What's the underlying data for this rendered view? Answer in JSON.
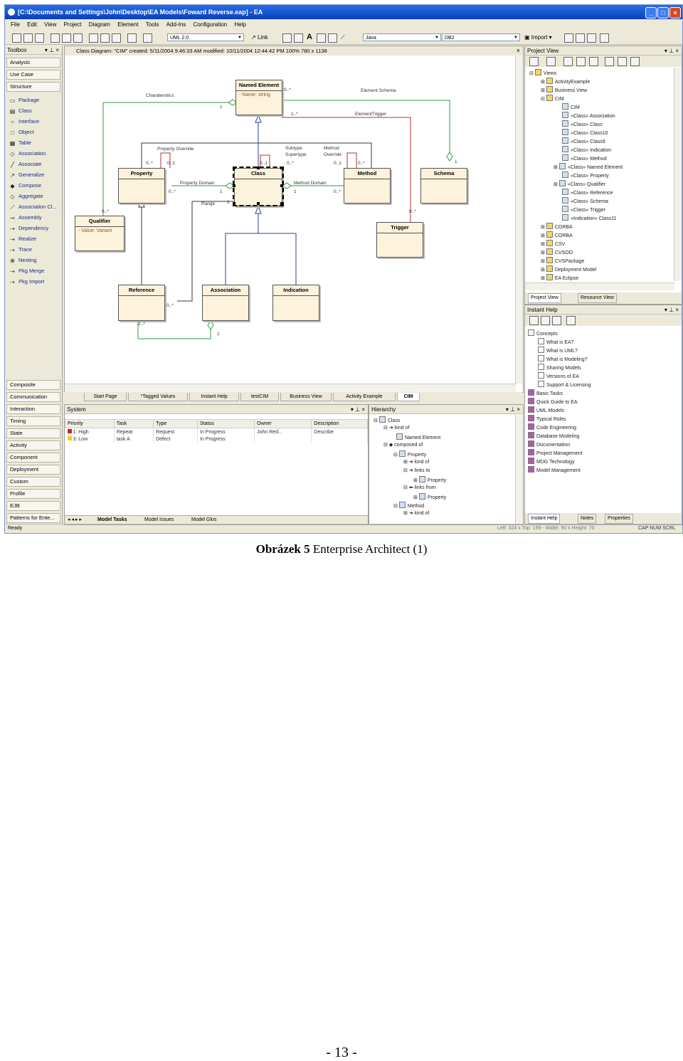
{
  "window": {
    "title": "[C:\\Documents and Settings\\John\\Desktop\\EA Models\\Foward Reverse.eap] - EA"
  },
  "menu": [
    "File",
    "Edit",
    "View",
    "Project",
    "Diagram",
    "Element",
    "Tools",
    "Add-Ins",
    "Configuration",
    "Help"
  ],
  "toolbar": {
    "uml_combo": "UML 2.0",
    "link_label": "Link",
    "lang_combo": "Java",
    "db_combo": "DB2",
    "import_label": "Import"
  },
  "toolbox": {
    "title": "Toolbox",
    "top_categories": [
      "Analysis",
      "Use Case",
      "Structure"
    ],
    "items": [
      "Package",
      "Class",
      "Interface",
      "Object",
      "Table",
      "Association",
      "Associate",
      "Generalize",
      "Compose",
      "Aggregate",
      "Association Cl...",
      "Assembly",
      "Dependency",
      "Realize",
      "Trace",
      "Nesting",
      "Pkg Merge",
      "Pkg Import"
    ],
    "bottom_categories": [
      "Composite",
      "Communication",
      "Interaction",
      "Timing",
      "State",
      "Activity",
      "Component",
      "Deployment",
      "Custom",
      "Profile",
      "EJB",
      "Patterns for Ente..."
    ]
  },
  "diagram": {
    "header": "Class Diagram: \"CIM\"   created: 5/11/2004 9:46:33 AM  modified: 10/11/2004 12:44:42 PM   100%   780 x 1138",
    "classes": {
      "named_element": {
        "name": "Named Element",
        "attr": "-  Name:  string"
      },
      "property": {
        "name": "Property"
      },
      "class": {
        "name": "Class"
      },
      "method": {
        "name": "Method"
      },
      "schema": {
        "name": "Schema"
      },
      "qualifier": {
        "name": "Qualifier",
        "attr": "-  Value:  Variant"
      },
      "trigger": {
        "name": "Trigger"
      },
      "reference": {
        "name": "Reference"
      },
      "association": {
        "name": "Association"
      },
      "indication": {
        "name": "Indication"
      }
    },
    "labels": {
      "characteristics": "Charateristics",
      "element_schema": "Element Schema",
      "element_trigger": "ElementTrigger",
      "property_override": "Property Override",
      "subtype": "Subtype",
      "supertype": "Supertype",
      "method_override_1": "Method",
      "method_override_2": "Override",
      "property_domain": "Property Domain",
      "method_domain": "Method Domain",
      "range": "Range",
      "m_0n": "0..*",
      "m_1": "1",
      "m_1n": "1..*",
      "m_01": "0..1",
      "m_2n": "2..*"
    }
  },
  "diagram_tabs": [
    "Start Page",
    "*Tagged Values",
    "Instant Help",
    "testCIM",
    "Business View",
    "Activity Example",
    "CIM"
  ],
  "system": {
    "title": "System",
    "columns": [
      "Priority",
      "Task",
      "Type",
      "Status",
      "Owner",
      "Description"
    ],
    "rows": [
      [
        "1: High",
        "Repeat",
        "Request",
        "In Progress",
        "John Red...",
        "Describe"
      ],
      [
        "3: Low",
        "task A",
        "Defect",
        "In Progress",
        "",
        ""
      ]
    ],
    "tabs": [
      "Model Tasks",
      "Model Issues",
      "Model Glos"
    ]
  },
  "hierarchy": {
    "title": "Hierarchy",
    "nodes": [
      "Class",
      "kind of",
      "Named Element",
      "composed of",
      "Property",
      "kind of",
      "links to",
      "Property",
      "links from",
      "Property",
      "Method",
      "kind of"
    ]
  },
  "project_view": {
    "title": "Project View",
    "nodes": [
      "Views",
      "ActivityExample",
      "Business View",
      "CIM",
      "CIM",
      "«Class» Association",
      "«Class» Class",
      "«Class» Class10",
      "«Class» Class9",
      "«Class» Indication",
      "«Class» Method",
      "«Class» Named Element",
      "«Class» Property",
      "«Class» Qualifier",
      "«Class» Reference",
      "«Class» Schema",
      "«Class» Trigger",
      "«Indication» Class11",
      "CORBA",
      "CORBA",
      "CSV",
      "CVSOO",
      "CVSPackage",
      "Deployment Model",
      "EA Eclipse"
    ],
    "tabs": [
      "Project View",
      "Resource View"
    ]
  },
  "instant_help": {
    "title": "Instant Help",
    "nodes": [
      "Concepts",
      "What is EA?",
      "What is UML?",
      "What is Modeling?",
      "Sharing Models",
      "Versions of EA",
      "Support & Licensing",
      "Basic Tasks",
      "Quick Guide to EA",
      "UML Models",
      "Typical Roles",
      "Code Engineering",
      "Database Modeling",
      "Documentation",
      "Project Management",
      "MDG Technology",
      "Model Management"
    ],
    "tabs": [
      "Instant Help",
      "Notes",
      "Properties"
    ]
  },
  "status": {
    "ready": "Ready",
    "coords": "Left:  324 x Top:  199 - Width:  90 x Height:  70",
    "caps": "CAP  NUM  SCRL"
  },
  "caption": {
    "bold": "Obrázek 5",
    "text": " Enterprise Architect (1)"
  },
  "page_number": "- 13 -"
}
